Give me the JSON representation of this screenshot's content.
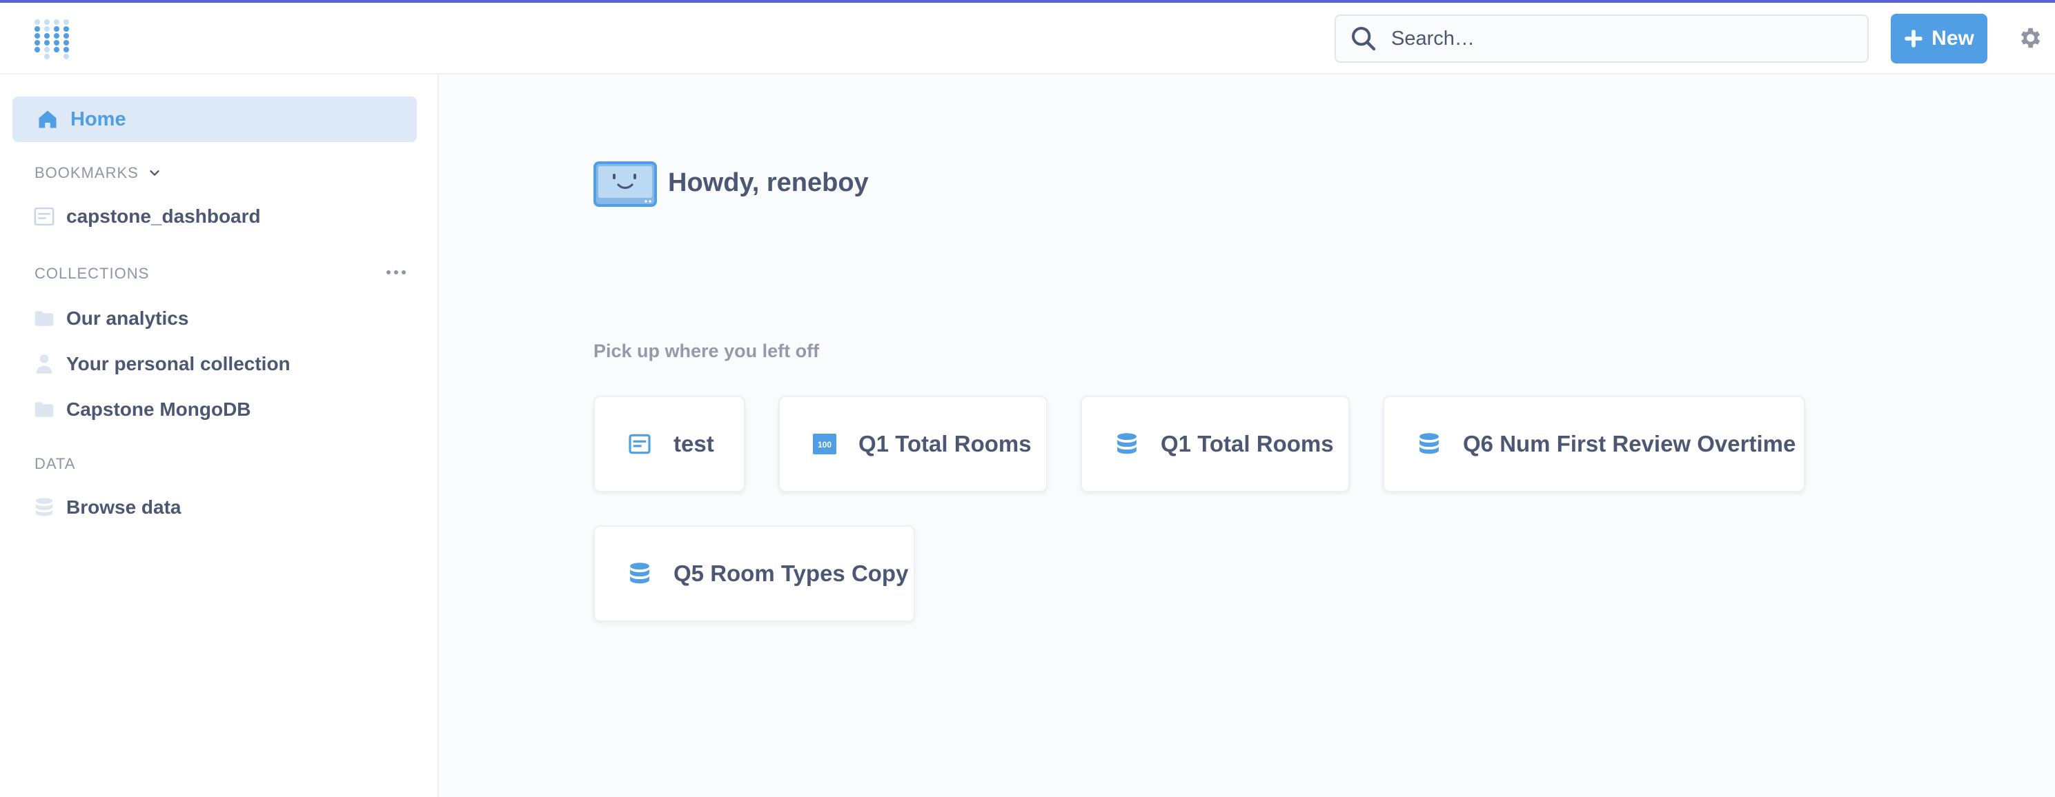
{
  "header": {
    "search_placeholder": "Search…",
    "new_label": "New"
  },
  "sidebar": {
    "home_label": "Home",
    "bookmarks_title": "BOOKMARKS",
    "bookmarks": [
      {
        "label": "capstone_dashboard",
        "icon": "dashboard-icon"
      }
    ],
    "collections_title": "COLLECTIONS",
    "collections": [
      {
        "label": "Our analytics",
        "icon": "folder-icon"
      },
      {
        "label": "Your personal collection",
        "icon": "person-icon"
      },
      {
        "label": "Capstone MongoDB",
        "icon": "folder-icon"
      }
    ],
    "data_title": "DATA",
    "data_items": [
      {
        "label": "Browse data",
        "icon": "database-icon"
      }
    ]
  },
  "main": {
    "greeting": "Howdy, reneboy",
    "pickup_title": "Pick up where you left off",
    "recent_items": [
      {
        "label": "test",
        "icon": "dashboard-icon"
      },
      {
        "label": "Q1 Total Rooms",
        "icon": "number-icon"
      },
      {
        "label": "Q1 Total Rooms",
        "icon": "database-icon"
      },
      {
        "label": "Q6 Num First Review Overtime",
        "icon": "database-icon"
      },
      {
        "label": "Q5 Room Types Copy",
        "icon": "database-icon"
      }
    ]
  },
  "colors": {
    "accent": "#509ee3",
    "active_bg": "#dde9f7",
    "top_line": "#5c5fd6",
    "text": "#4c5773",
    "muted": "#949aab"
  }
}
